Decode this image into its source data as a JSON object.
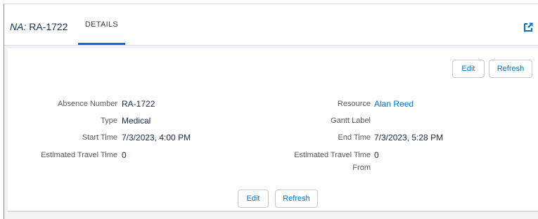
{
  "header": {
    "title_prefix": "NA:",
    "title_value": "RA-1722",
    "tab_details": "DETAILS",
    "popout_icon": "new-window-icon"
  },
  "actions": {
    "edit_label": "Edit",
    "refresh_label": "Refresh"
  },
  "fields": {
    "absence_number": {
      "label": "Absence Number",
      "value": "RA-1722"
    },
    "type": {
      "label": "Type",
      "value": "Medical"
    },
    "start_time": {
      "label": "Start Time",
      "value": "7/3/2023, 4:00 PM"
    },
    "estimated_travel_time": {
      "label": "Estimated Travel Time",
      "value": "0"
    },
    "resource": {
      "label": "Resource",
      "value": "Alan Reed"
    },
    "gantt_label": {
      "label": "Gantt Label",
      "value": ""
    },
    "end_time": {
      "label": "End Time",
      "value": "7/3/2023, 5:28 PM"
    },
    "estimated_travel_time_from": {
      "label_line1": "Estimated Travel Time",
      "label_line2": "From",
      "value": "0"
    }
  },
  "colors": {
    "accent": "#0070d2",
    "title": "#16325c",
    "border": "#d8dde6"
  }
}
